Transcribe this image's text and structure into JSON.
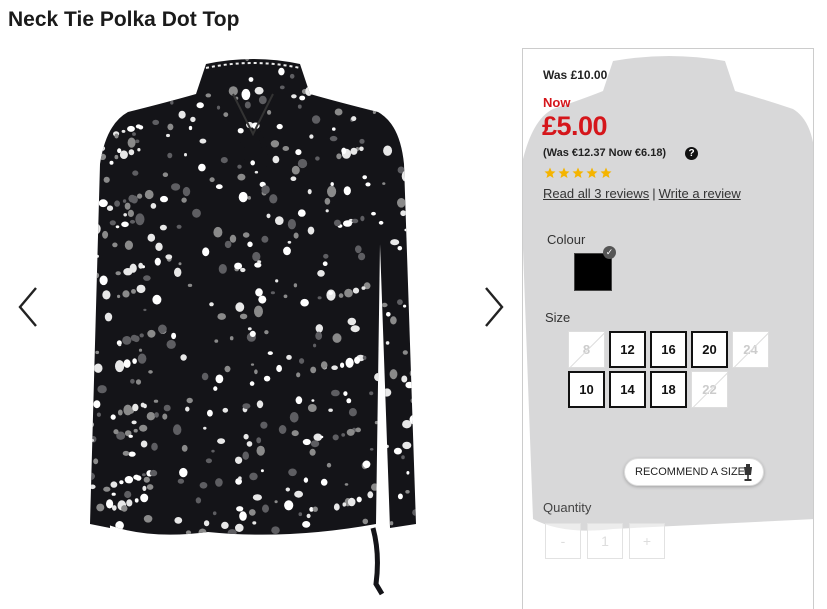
{
  "product": {
    "title": "Neck Tie Polka Dot Top"
  },
  "gallery": {
    "prev_icon": "chevron-left-icon",
    "next_icon": "chevron-right-icon"
  },
  "pricing": {
    "was": "Was £10.00",
    "now_label": "Now",
    "now_price": "£5.00",
    "euro": "(Was €12.37 Now €6.18)",
    "help_glyph": "?",
    "rating_stars": 5,
    "read_reviews": "Read all 3 reviews",
    "separator": "|",
    "write_review": "Write a review"
  },
  "colour": {
    "label": "Colour",
    "selected_color": "#000000",
    "check_glyph": "✓"
  },
  "size": {
    "label": "Size",
    "options": [
      {
        "label": "8",
        "available": false
      },
      {
        "label": "12",
        "available": true
      },
      {
        "label": "16",
        "available": true
      },
      {
        "label": "20",
        "available": true
      },
      {
        "label": "24",
        "available": false
      },
      {
        "label": "10",
        "available": true
      },
      {
        "label": "14",
        "available": true
      },
      {
        "label": "18",
        "available": true
      },
      {
        "label": "22",
        "available": false
      }
    ]
  },
  "recommend": {
    "label": "RECOMMEND A SIZE"
  },
  "quantity": {
    "label": "Quantity",
    "minus": "-",
    "value": "1",
    "plus": "+"
  },
  "colors": {
    "sale_red": "#d5161b",
    "star_gold": "#f5b400",
    "garment": "#141418"
  }
}
